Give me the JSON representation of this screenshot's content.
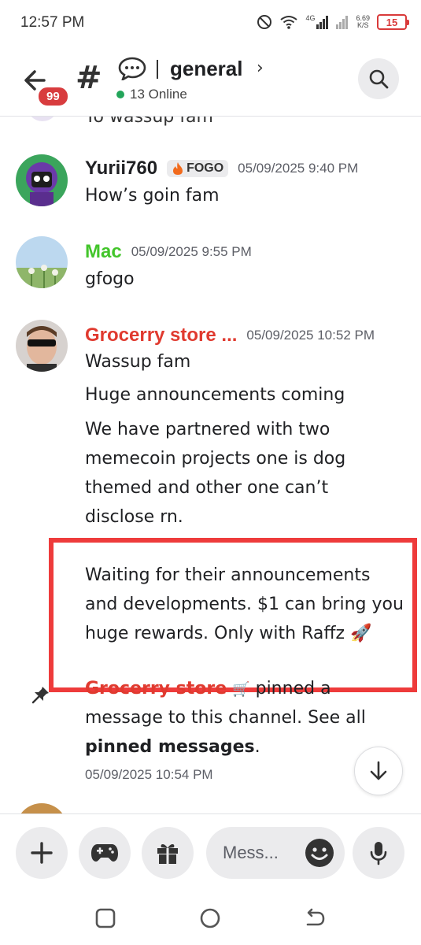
{
  "status_bar": {
    "time": "12:57 PM",
    "network": "4G",
    "speed_value": "6.69",
    "speed_unit": "K/S",
    "battery": "15"
  },
  "header": {
    "unread_badge": "99",
    "channel_name": "general",
    "online": "13 Online"
  },
  "messages": {
    "cut_off_text": "Yo wassup fam",
    "items": [
      {
        "author": "Yurii760",
        "author_color": "#1f2023",
        "tag": "FOGO",
        "timestamp": "05/09/2025 9:40 PM",
        "lines": [
          "How’s goin fam"
        ]
      },
      {
        "author": "Mac",
        "author_color": "#43c52b",
        "timestamp": "05/09/2025 9:55 PM",
        "lines": [
          "gfogo"
        ]
      },
      {
        "author": "Grocerry store  ...",
        "author_color": "#e03a2f",
        "timestamp": "05/09/2025 10:52 PM",
        "lines": [
          "Wassup fam",
          "Huge announcements coming",
          "We have partnered with two",
          "memecoin projects one is dog",
          "themed and other one can’t",
          "disclose rn.",
          "Waiting for their announcements",
          "and developments. $1 can bring you",
          "huge rewards. Only with Raffz 🚀"
        ]
      }
    ]
  },
  "system_message": {
    "author": "Grocerry store",
    "action": "pinned a",
    "line2": "message to this channel. See all",
    "link": "pinned messages",
    "suffix": ".",
    "timestamp": "05/09/2025 10:54 PM"
  },
  "composer": {
    "placeholder": "Mess..."
  },
  "colors": {
    "highlight_border": "#ee3b3b",
    "online": "#23a55a",
    "badge": "#d83c3e"
  }
}
